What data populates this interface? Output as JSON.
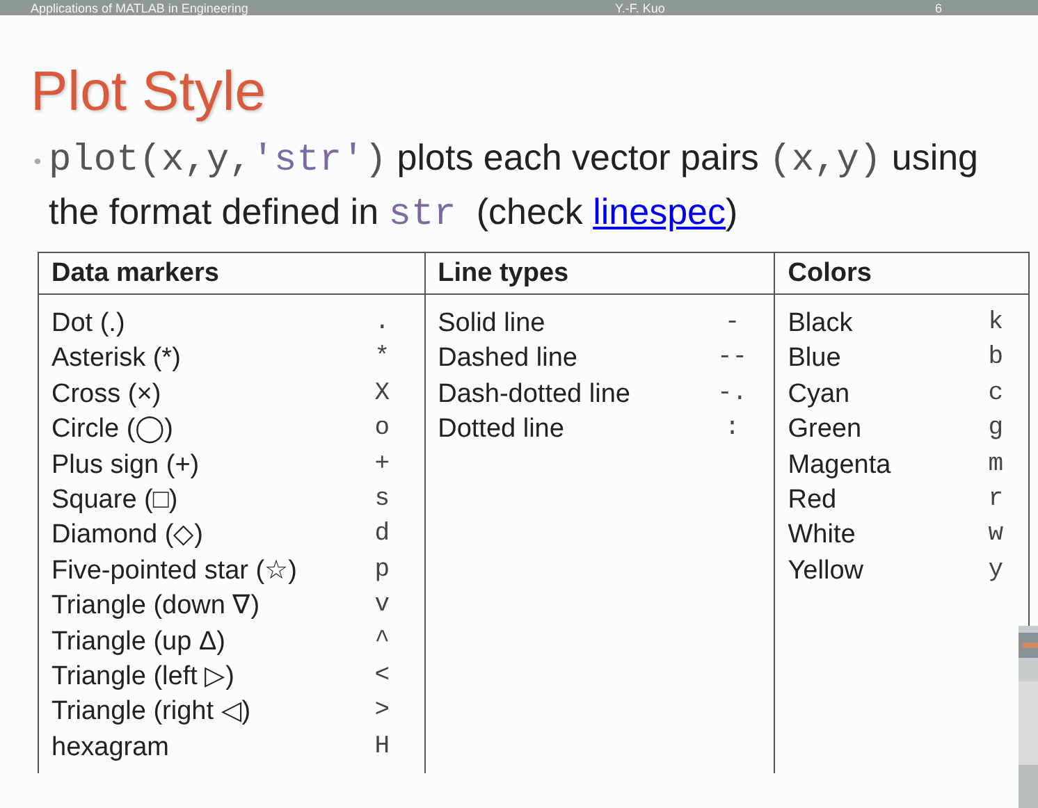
{
  "top_bar": {
    "course": "Applications of MATLAB in Engineering",
    "author": "Y.-F. Kuo",
    "page": "6"
  },
  "slide": {
    "title": "Plot Style",
    "bullet": [
      {
        "kind": "code",
        "text": "plot(x,y,"
      },
      {
        "kind": "code-string",
        "text": "'str'"
      },
      {
        "kind": "code",
        "text": ")"
      },
      {
        "kind": "text",
        "text": " plots each vector pairs "
      },
      {
        "kind": "code",
        "text": "(x,y)"
      },
      {
        "kind": "text",
        "text": " using the format defined in "
      },
      {
        "kind": "code-string",
        "text": "str"
      },
      {
        "kind": "text",
        "text": "  (check "
      },
      {
        "kind": "link",
        "text": "linespec"
      },
      {
        "kind": "text",
        "text": ")"
      }
    ],
    "table": {
      "columns": [
        {
          "heading": "Data markers",
          "rows": [
            {
              "name": "Dot (.)",
              "symbol": "."
            },
            {
              "name": "Asterisk (*)",
              "symbol": "*"
            },
            {
              "name": "Cross (×)",
              "symbol": "X"
            },
            {
              "name": "Circle (◯)",
              "symbol": "o"
            },
            {
              "name": "Plus sign (+)",
              "symbol": "+"
            },
            {
              "name": "Square (□)",
              "symbol": "s"
            },
            {
              "name": "Diamond (◇)",
              "symbol": "d"
            },
            {
              "name": "Five-pointed star (☆)",
              "symbol": "p"
            },
            {
              "name": "Triangle (down ∇)",
              "symbol": "v"
            },
            {
              "name": "Triangle (up Δ)",
              "symbol": "^"
            },
            {
              "name": "Triangle (left ▷)",
              "symbol": "<"
            },
            {
              "name": "Triangle (right ◁)",
              "symbol": ">"
            },
            {
              "name": "hexagram",
              "symbol": "H"
            }
          ]
        },
        {
          "heading": "Line types",
          "rows": [
            {
              "name": "Solid line",
              "symbol": "-"
            },
            {
              "name": "Dashed line",
              "symbol": "--"
            },
            {
              "name": "Dash-dotted line",
              "symbol": "-."
            },
            {
              "name": "Dotted line",
              "symbol": ":"
            }
          ]
        },
        {
          "heading": "Colors",
          "rows": [
            {
              "name": "Black",
              "symbol": "k"
            },
            {
              "name": "Blue",
              "symbol": "b"
            },
            {
              "name": "Cyan",
              "symbol": "c"
            },
            {
              "name": "Green",
              "symbol": "g"
            },
            {
              "name": "Magenta",
              "symbol": "m"
            },
            {
              "name": "Red",
              "symbol": "r"
            },
            {
              "name": "White",
              "symbol": "w"
            },
            {
              "name": "Yellow",
              "symbol": "y"
            }
          ]
        }
      ]
    }
  }
}
